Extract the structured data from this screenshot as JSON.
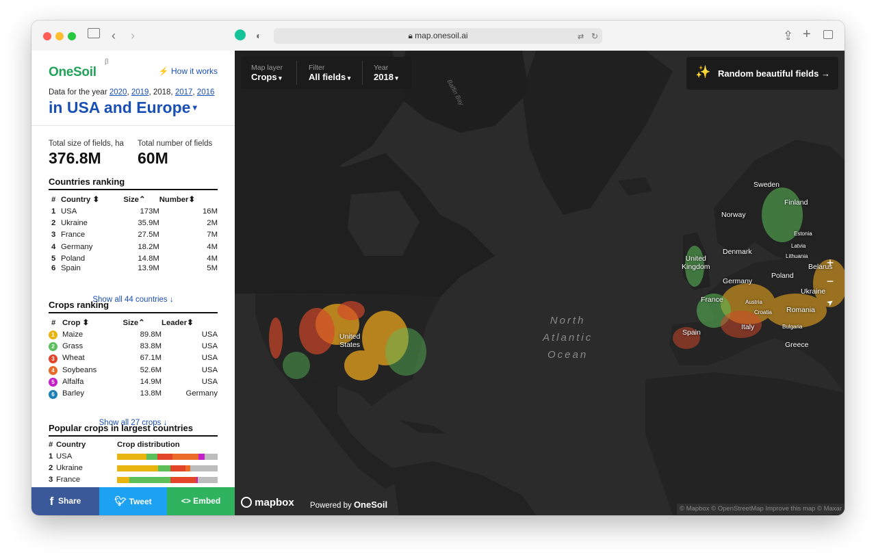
{
  "browser": {
    "url": "map.onesoil.ai",
    "colors": {
      "close": "#ff5f57",
      "minimize": "#febc2e",
      "zoom": "#28c840"
    }
  },
  "sidebar": {
    "brand": "OneSoil",
    "beta": "β",
    "how_it_works": "How it works",
    "year_prefix": "Data for the year",
    "years": [
      "2020",
      "2019",
      "2018",
      "2017",
      "2016"
    ],
    "region": "in USA and Europe",
    "total_size_label": "Total size of fields, ha",
    "total_size_value": "376.8M",
    "total_count_label": "Total number of fields",
    "total_count_value": "60M",
    "countries_title": "Countries ranking",
    "countries_headers": [
      "#",
      "Country",
      "Size",
      "Number"
    ],
    "countries": [
      {
        "n": "1",
        "name": "USA",
        "size": "173M",
        "number": "16M"
      },
      {
        "n": "2",
        "name": "Ukraine",
        "size": "35.9M",
        "number": "2M"
      },
      {
        "n": "3",
        "name": "France",
        "size": "27.5M",
        "number": "7M"
      },
      {
        "n": "4",
        "name": "Germany",
        "size": "18.2M",
        "number": "4M"
      },
      {
        "n": "5",
        "name": "Poland",
        "size": "14.8M",
        "number": "4M"
      },
      {
        "n": "6",
        "name": "Spain",
        "size": "13.9M",
        "number": "5M"
      }
    ],
    "countries_show_all": "Show all 44 countries ↓",
    "crops_title": "Crops ranking",
    "crops_headers": [
      "#",
      "Crop",
      "Size",
      "Leader"
    ],
    "crops": [
      {
        "n": "1",
        "name": "Maize",
        "size": "89.8M",
        "leader": "USA",
        "color": "#e8b410"
      },
      {
        "n": "2",
        "name": "Grass",
        "size": "83.8M",
        "leader": "USA",
        "color": "#5cbf5a"
      },
      {
        "n": "3",
        "name": "Wheat",
        "size": "67.1M",
        "leader": "USA",
        "color": "#e2452a"
      },
      {
        "n": "4",
        "name": "Soybeans",
        "size": "52.6M",
        "leader": "USA",
        "color": "#ea6a27"
      },
      {
        "n": "5",
        "name": "Alfalfa",
        "size": "14.9M",
        "leader": "USA",
        "color": "#c41ec8"
      },
      {
        "n": "6",
        "name": "Barley",
        "size": "13.8M",
        "leader": "Germany",
        "color": "#1b7fb8"
      }
    ],
    "crops_show_all": "Show all 27 crops ↓",
    "popular_title": "Popular crops in largest countries",
    "popular_headers": [
      "#",
      "Country",
      "Crop distribution"
    ],
    "popular": [
      {
        "n": "1",
        "name": "USA",
        "dist": [
          {
            "c": "#e8b410",
            "v": 0.29
          },
          {
            "c": "#5cbf5a",
            "v": 0.11
          },
          {
            "c": "#e2452a",
            "v": 0.15
          },
          {
            "c": "#ea6a27",
            "v": 0.26
          },
          {
            "c": "#c41ec8",
            "v": 0.06
          },
          {
            "c": "#bdbdbd",
            "v": 0.13
          }
        ]
      },
      {
        "n": "2",
        "name": "Ukraine",
        "dist": [
          {
            "c": "#e8b410",
            "v": 0.41
          },
          {
            "c": "#5cbf5a",
            "v": 0.12
          },
          {
            "c": "#e2452a",
            "v": 0.15
          },
          {
            "c": "#ea6a27",
            "v": 0.05
          },
          {
            "c": "#bdbdbd",
            "v": 0.27
          }
        ]
      },
      {
        "n": "3",
        "name": "France",
        "dist": [
          {
            "c": "#e8b410",
            "v": 0.12
          },
          {
            "c": "#5cbf5a",
            "v": 0.41
          },
          {
            "c": "#e2452a",
            "v": 0.26
          },
          {
            "c": "#c41ec8",
            "v": 0.01
          },
          {
            "c": "#bdbdbd",
            "v": 0.2
          }
        ]
      }
    ],
    "share": {
      "share": "Share",
      "tweet": "Tweet",
      "embed": "Embed"
    },
    "share_colors": {
      "share": "#3b5998",
      "tweet": "#1da1f2",
      "embed": "#2fb35f"
    }
  },
  "map": {
    "layer_label": "Map layer",
    "layer_value": "Crops",
    "filter_label": "Filter",
    "filter_value": "All fields",
    "year_label": "Year",
    "year_value": "2018",
    "random_label": "Random beautiful fields →",
    "ocean_label": [
      "North",
      "Atlantic",
      "Ocean"
    ],
    "bay_label": "Baffin Bay",
    "places": [
      {
        "name": "United\nStates",
        "cls": ""
      },
      {
        "name": "Sweden",
        "cls": ""
      },
      {
        "name": "Finland",
        "cls": ""
      },
      {
        "name": "Norway",
        "cls": ""
      },
      {
        "name": "Estonia",
        "cls": "sm"
      },
      {
        "name": "Latvia",
        "cls": "sm"
      },
      {
        "name": "Lithuania",
        "cls": "sm"
      },
      {
        "name": "Denmark",
        "cls": ""
      },
      {
        "name": "United\nKingdom",
        "cls": ""
      },
      {
        "name": "Belarus",
        "cls": ""
      },
      {
        "name": "Poland",
        "cls": ""
      },
      {
        "name": "Germany",
        "cls": ""
      },
      {
        "name": "Ukraine",
        "cls": ""
      },
      {
        "name": "France",
        "cls": ""
      },
      {
        "name": "Austria",
        "cls": "sm"
      },
      {
        "name": "Croatia",
        "cls": "sm"
      },
      {
        "name": "Romania",
        "cls": ""
      },
      {
        "name": "Bulgaria",
        "cls": "sm"
      },
      {
        "name": "Spain",
        "cls": ""
      },
      {
        "name": "Italy",
        "cls": ""
      },
      {
        "name": "Greece",
        "cls": ""
      }
    ],
    "zoom_in": "+",
    "zoom_out": "−",
    "compass": "➤",
    "mapbox": "mapbox",
    "powered_by": "Powered by",
    "powered_brand": "OneSoil",
    "attribution": "© Mapbox © OpenStreetMap Improve this map © Maxar"
  }
}
